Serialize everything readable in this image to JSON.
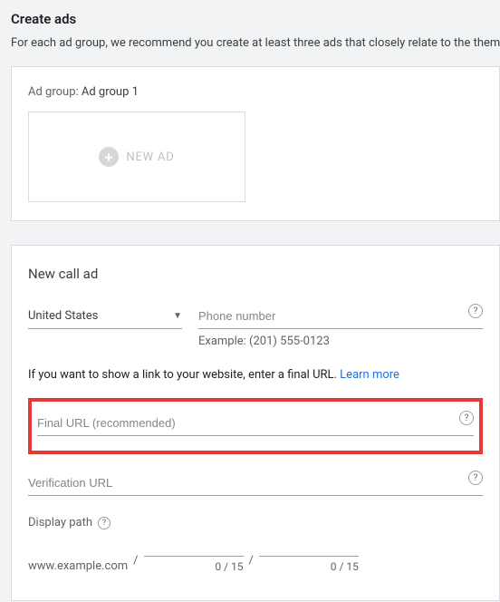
{
  "page": {
    "title": "Create ads",
    "subtitle": "For each ad group, we recommend you create at least three ads that closely relate to the theme of you"
  },
  "adgroup": {
    "label_prefix": "Ad group:",
    "name": "Ad group 1",
    "new_ad_label": "NEW AD"
  },
  "form": {
    "title": "New call ad",
    "country_selected": "United States",
    "phone_placeholder": "Phone number",
    "phone_example": "Example: (201) 555-0123",
    "link_hint_text": "If you want to show a link to your website, enter a final URL. ",
    "learn_more": "Learn more",
    "final_url_placeholder": "Final URL (recommended)",
    "verification_url_placeholder": "Verification URL",
    "display_path_label": "Display path",
    "display_path_domain": "www.example.com",
    "path1_counter": "0 / 15",
    "path2_counter": "0 / 15"
  }
}
